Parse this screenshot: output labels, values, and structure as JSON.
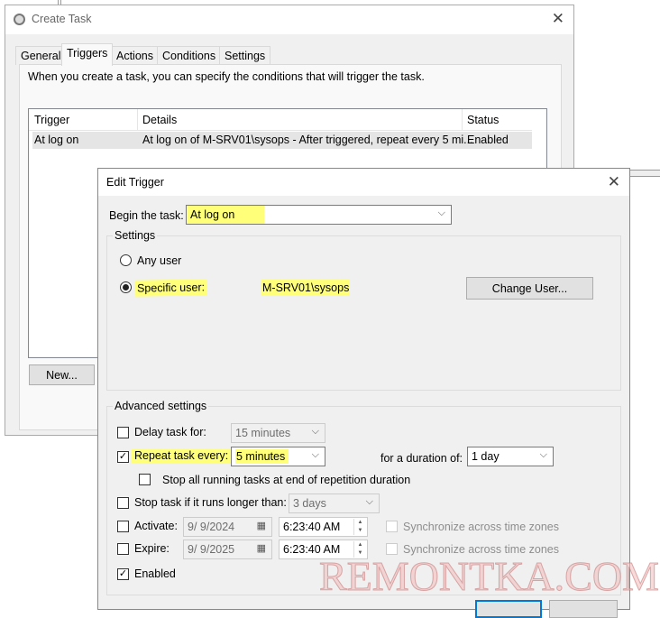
{
  "create_task": {
    "title": "Create Task",
    "tabs": [
      "General",
      "Triggers",
      "Actions",
      "Conditions",
      "Settings"
    ],
    "active_tab": "Triggers",
    "description": "When you create a task, you can specify the conditions that will trigger the task.",
    "columns": [
      "Trigger",
      "Details",
      "Status"
    ],
    "rows": [
      {
        "trigger": "At log on",
        "details": "At log on of M-SRV01\\sysops - After triggered, repeat every 5 mi...",
        "status": "Enabled"
      }
    ],
    "new_button": "New..."
  },
  "edit_trigger": {
    "title": "Edit Trigger",
    "begin_label": "Begin the task:",
    "begin_value": "At log on",
    "settings_label": "Settings",
    "any_user": "Any user",
    "specific_user": "Specific user:",
    "user_value": "M-SRV01\\sysops",
    "change_user": "Change User...",
    "advanced_label": "Advanced settings",
    "delay_label": "Delay task for:",
    "delay_value": "15 minutes",
    "delay_checked": false,
    "repeat_label": "Repeat task every:",
    "repeat_value": "5 minutes",
    "repeat_checked": true,
    "duration_label": "for a duration of:",
    "duration_value": "1 day",
    "stop_all_label": "Stop all running tasks at end of repetition duration",
    "stop_all_checked": false,
    "stop_longer_label": "Stop task if it runs longer than:",
    "stop_longer_value": "3 days",
    "stop_longer_checked": false,
    "activate_label": "Activate:",
    "activate_date": "9/  9/2024",
    "activate_time": "6:23:40 AM",
    "expire_label": "Expire:",
    "expire_date": "9/  9/2025",
    "expire_time": "6:23:40 AM",
    "sync_label": "Synchronize across time zones",
    "enabled_label": "Enabled",
    "enabled_checked": true
  },
  "watermark": "REMONTKA.COM",
  "highlight_color": "#ffff7a"
}
